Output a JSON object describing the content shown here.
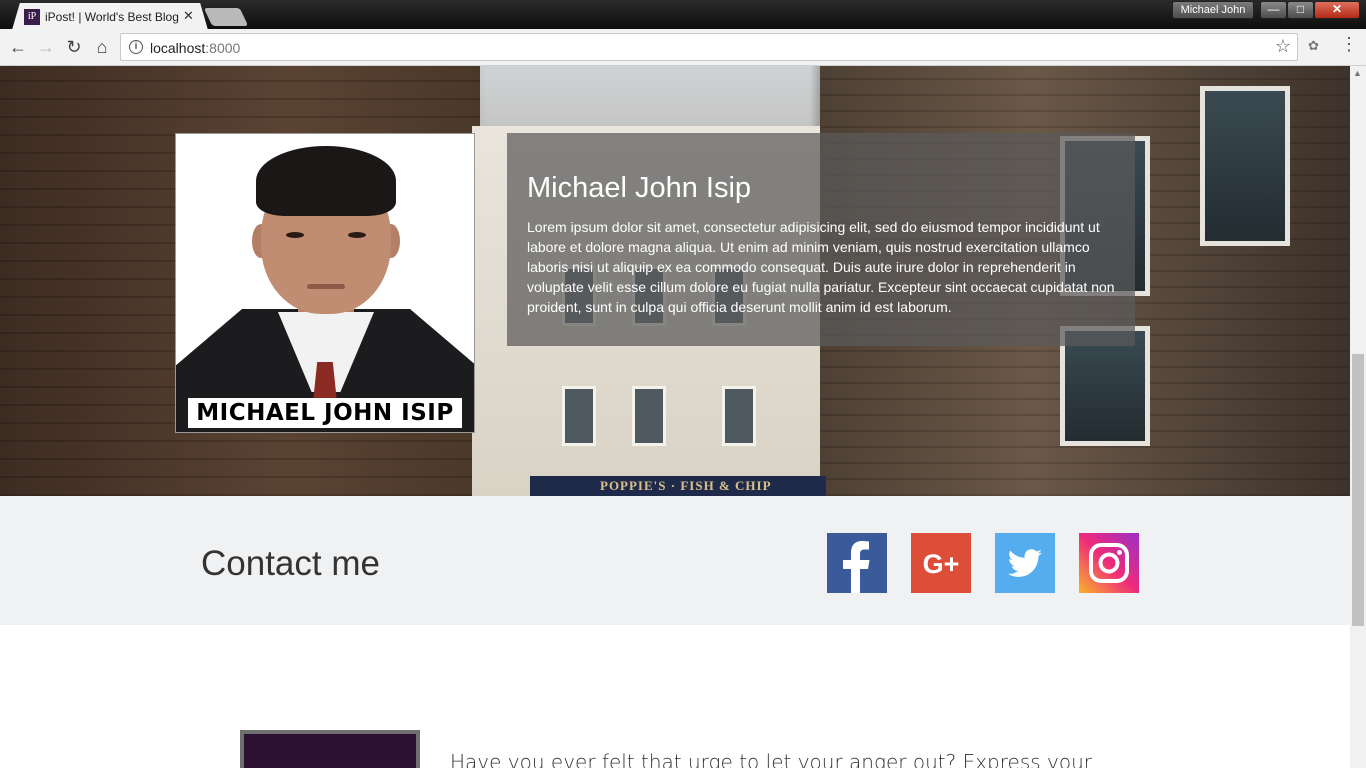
{
  "browser": {
    "tab_title": "iPost! | World's Best Blog",
    "tab_favicon": "iP",
    "tab_close": "✕",
    "profile_name": "Michael John",
    "url_host": "localhost",
    "url_port": ":8000",
    "icons": [
      "back-arrow-icon",
      "forward-arrow-icon",
      "reload-icon",
      "home-icon",
      "info-icon",
      "star-icon",
      "extension-icon",
      "menu-icon"
    ]
  },
  "hero": {
    "photo_caption": "MICHAEL JOHN ISIP",
    "name": "Michael John Isip",
    "bio": "Lorem ipsum dolor sit amet, consectetur adipisicing elit, sed do eiusmod tempor incididunt ut labore et dolore magna aliqua. Ut enim ad minim veniam, quis nostrud exercitation ullamco laboris nisi ut aliquip ex ea commodo consequat. Duis aute irure dolor in reprehenderit in voluptate velit esse cillum dolore eu fugiat nulla pariatur. Excepteur sint occaecat cupidatat non proident, sunt in culpa qui officia deserunt mollit anim id est laborum.",
    "sign_text": "POPPIE'S · FISH & CHIP"
  },
  "contact": {
    "title": "Contact me",
    "social": [
      {
        "name": "facebook",
        "color": "#3b5a9a"
      },
      {
        "name": "google-plus",
        "color": "#dc4e37"
      },
      {
        "name": "twitter",
        "color": "#55acee"
      },
      {
        "name": "instagram",
        "color": "#c13584"
      }
    ]
  },
  "article": {
    "text": "Have you ever felt that urge to let your anger out? Express your feelings"
  }
}
